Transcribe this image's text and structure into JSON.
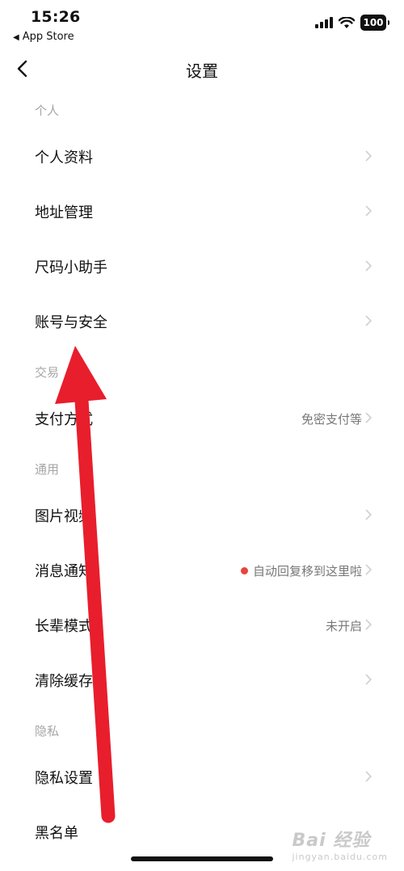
{
  "status": {
    "time": "15:26",
    "back_app": "App Store",
    "battery": "100"
  },
  "nav": {
    "title": "设置"
  },
  "sections": [
    {
      "header": "个人",
      "items": [
        {
          "label": "个人资料",
          "value": ""
        },
        {
          "label": "地址管理",
          "value": ""
        },
        {
          "label": "尺码小助手",
          "value": ""
        },
        {
          "label": "账号与安全",
          "value": ""
        }
      ]
    },
    {
      "header": "交易",
      "items": [
        {
          "label": "支付方式",
          "value": "免密支付等"
        }
      ]
    },
    {
      "header": "通用",
      "items": [
        {
          "label": "图片视频",
          "value": ""
        },
        {
          "label": "消息通知",
          "value": "自动回复移到这里啦"
        },
        {
          "label": "长辈模式",
          "value": "未开启"
        },
        {
          "label": "清除缓存",
          "value": ""
        }
      ]
    },
    {
      "header": "隐私",
      "items": [
        {
          "label": "隐私设置",
          "value": ""
        },
        {
          "label": "黑名单",
          "value": ""
        }
      ]
    }
  ],
  "watermark": {
    "text": "Bai 经验",
    "sub": "jingyan.baidu.com"
  },
  "colors": {
    "annotation_arrow": "#e81e2c",
    "notification_dot": "#e8443a"
  },
  "icons": {
    "back": "chevron-left-icon",
    "row": "chevron-right-icon"
  }
}
